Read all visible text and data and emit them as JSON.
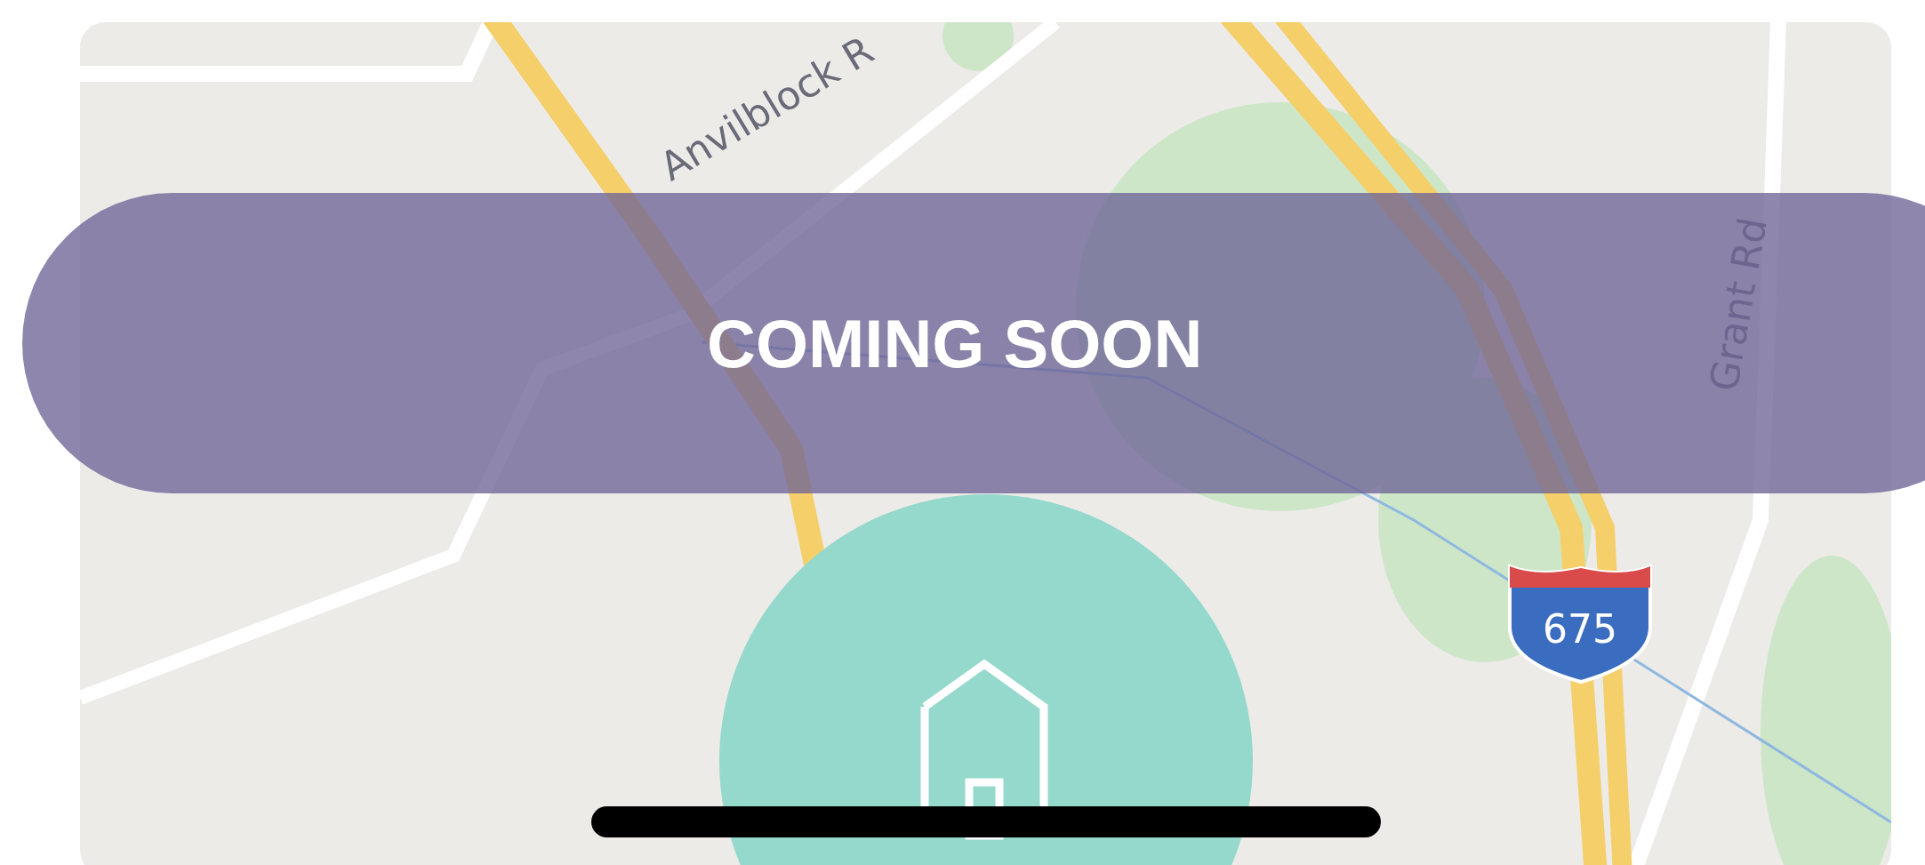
{
  "map": {
    "labels": [
      {
        "kind": "road",
        "text": "Anvilblock R"
      },
      {
        "kind": "road",
        "text": "Grant Rd"
      },
      {
        "kind": "shield",
        "text": "675"
      }
    ]
  },
  "banner": {
    "text": "COMING SOON"
  }
}
